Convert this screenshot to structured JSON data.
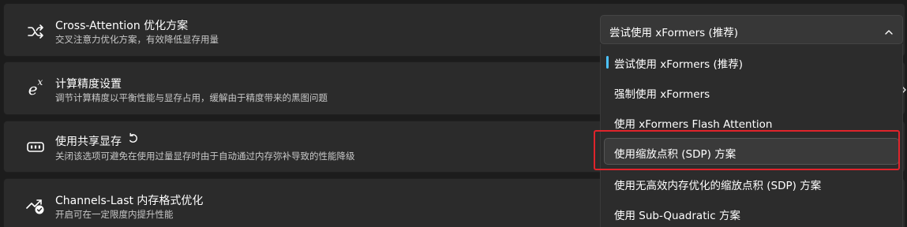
{
  "settings": [
    {
      "icon": "shuffle-icon",
      "title": "Cross-Attention 优化方案",
      "desc": "交叉注意力优化方案，有效降低显存用量"
    },
    {
      "icon": "exponent-icon",
      "icon_text": "e",
      "icon_sup": "x",
      "title": "计算精度设置",
      "desc": "调节计算精度以平衡性能与显存占用，缓解由于精度带来的黑图问题"
    },
    {
      "icon": "gpu-memory-icon",
      "title": "使用共享显存",
      "desc": "关闭该选项可避免在使用过量显存时由于自动通过内存弥补导致的性能降级"
    },
    {
      "icon": "trending-up-check-icon",
      "title": "Channels-Last 内存格式优化",
      "desc": "开启可在一定限度内提升性能"
    }
  ],
  "combo": {
    "value": "尝试使用 xFormers (推荐)"
  },
  "options": [
    "尝试使用 xFormers (推荐)",
    "强制使用 xFormers",
    "使用 xFormers Flash Attention",
    "使用缩放点积 (SDP) 方案",
    "使用无高效内存优化的缩放点积 (SDP) 方案",
    "使用 Sub-Quadratic 方案"
  ],
  "selected_index": 0,
  "hover_index": 3,
  "colors": {
    "accent": "#4cc2ff",
    "highlight": "#e0242b",
    "card": "#2b2b2b",
    "background": "#1c1c1c"
  }
}
